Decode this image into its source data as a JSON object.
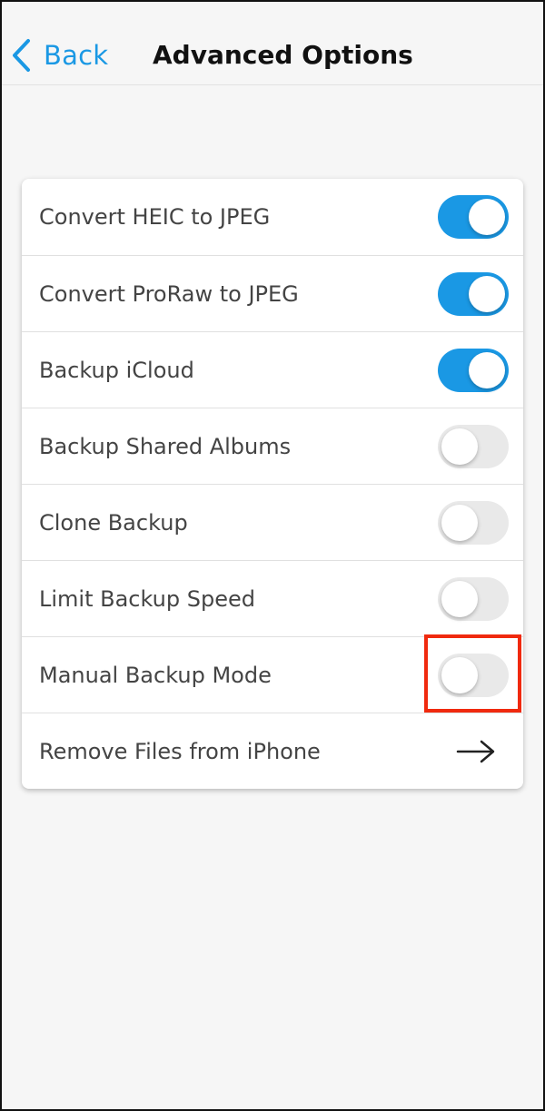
{
  "nav": {
    "back_label": "Back",
    "title": "Advanced Options",
    "accent_color": "#1a98e4"
  },
  "settings": [
    {
      "label": "Convert HEIC to JPEG",
      "control": "toggle",
      "state": "on"
    },
    {
      "label": "Convert ProRaw to JPEG",
      "control": "toggle",
      "state": "on"
    },
    {
      "label": "Backup iCloud",
      "control": "toggle",
      "state": "on"
    },
    {
      "label": "Backup Shared Albums",
      "control": "toggle",
      "state": "off"
    },
    {
      "label": "Clone Backup",
      "control": "toggle",
      "state": "off"
    },
    {
      "label": "Limit Backup Speed",
      "control": "toggle",
      "state": "off"
    },
    {
      "label": "Manual Backup Mode",
      "control": "toggle",
      "state": "off"
    },
    {
      "label": "Remove Files from iPhone",
      "control": "arrow",
      "icon": "arrow-right-icon"
    }
  ],
  "highlight": {
    "target": "Manual Backup Mode toggle",
    "color": "#f0290e"
  }
}
